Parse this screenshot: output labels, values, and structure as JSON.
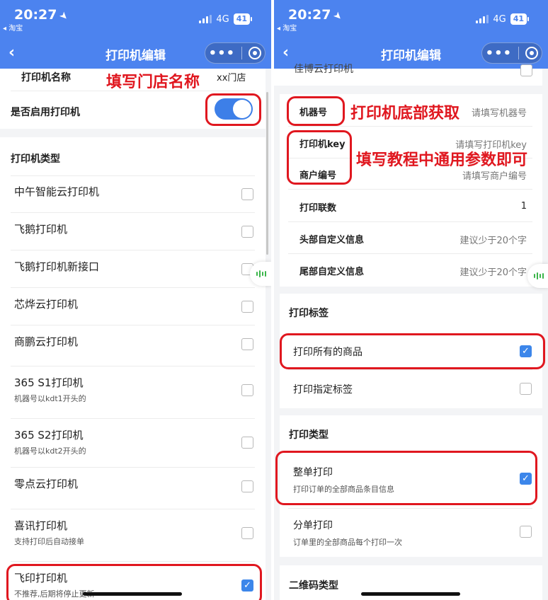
{
  "status_bar": {
    "time": "20:27",
    "back_app": "◂ 淘宝",
    "network": "4G",
    "battery": "41"
  },
  "nav": {
    "back": "‹",
    "title": "打印机编辑",
    "more": "•••"
  },
  "left": {
    "printer_name_label": "打印机名称",
    "printer_name_value": "xx门店",
    "enable_label": "是否启用打印机",
    "enable_state": true,
    "type_section_title": "打印机类型",
    "printer_types": [
      {
        "name": "中午智能云打印机",
        "sub": "",
        "checked": false
      },
      {
        "name": "飞鹅打印机",
        "sub": "",
        "checked": false
      },
      {
        "name": "飞鹅打印机新接口",
        "sub": "",
        "checked": false
      },
      {
        "name": "芯烨云打印机",
        "sub": "",
        "checked": false
      },
      {
        "name": "商鹏云打印机",
        "sub": "",
        "checked": false
      },
      {
        "name": "365 S1打印机",
        "sub": "机器号以kdt1开头的",
        "checked": false
      },
      {
        "name": "365 S2打印机",
        "sub": "机器号以kdt2开头的",
        "checked": false
      },
      {
        "name": "零点云打印机",
        "sub": "",
        "checked": false
      },
      {
        "name": "喜讯打印机",
        "sub": "支持打印后自动接单",
        "checked": false
      },
      {
        "name": "飞印打印机",
        "sub": "不推荐,后期将停止更新",
        "checked": true
      }
    ]
  },
  "right": {
    "top_partial_label": "佳博云打印机",
    "fields": [
      {
        "label": "机器号",
        "placeholder": "请填写机器号"
      },
      {
        "label": "打印机key",
        "placeholder": "请填写打印机key"
      },
      {
        "label": "商户编号",
        "placeholder": "请填写商户编号"
      },
      {
        "label": "打印联数",
        "placeholder": "1"
      },
      {
        "label": "头部自定义信息",
        "placeholder": "建议少于20个字"
      },
      {
        "label": "尾部自定义信息",
        "placeholder": "建议少于20个字"
      }
    ],
    "label_section_title": "打印标签",
    "label_options": [
      {
        "name": "打印所有的商品",
        "checked": true
      },
      {
        "name": "打印指定标签",
        "checked": false
      }
    ],
    "print_type_title": "打印类型",
    "print_types": [
      {
        "name": "整单打印",
        "sub": "打印订单的全部商品条目信息",
        "checked": true
      },
      {
        "name": "分单打印",
        "sub": "订单里的全部商品每个打印一次",
        "checked": false
      }
    ],
    "qrcode_section_title": "二维码类型"
  },
  "annotations": {
    "store_name": "填写门店名称",
    "machine_no": "打印机底部获取",
    "common_params": "填写教程中通用参数即可"
  },
  "colors": {
    "header_blue": "#4c83ef",
    "annotation_red": "#e0171f",
    "check_blue": "#3c86ea"
  },
  "icons": [
    "location-arrow-icon",
    "signal-icon",
    "battery-icon",
    "back-chevron-icon",
    "more-dots-icon",
    "target-icon",
    "checkbox-icon",
    "voice-float-icon"
  ]
}
